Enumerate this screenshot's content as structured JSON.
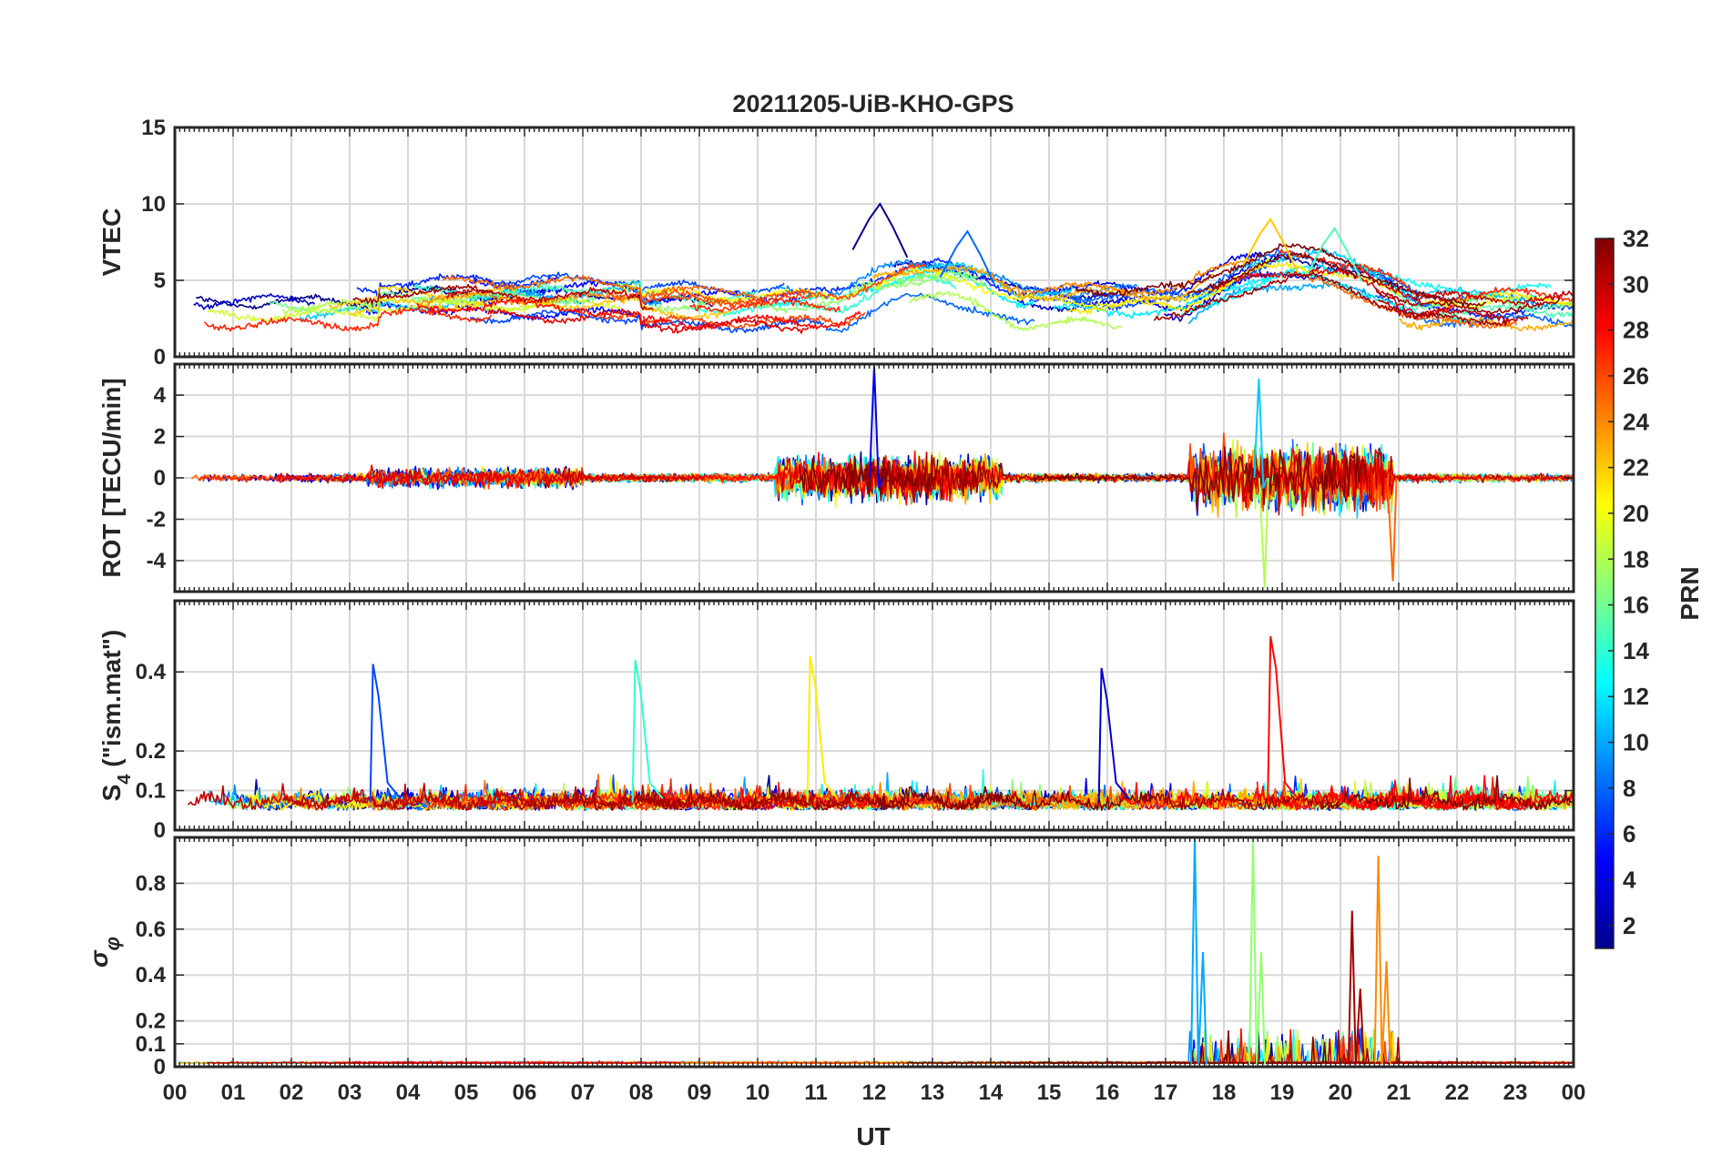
{
  "colors": {
    "axis": "#262626",
    "grid": "#d9d9d9",
    "background": "#ffffff",
    "colormap": [
      "#00008f",
      "#0000ff",
      "#0080ff",
      "#00ffff",
      "#80ff80",
      "#ffff00",
      "#ff8000",
      "#ff0000",
      "#800000"
    ]
  },
  "chart_data": {
    "type": "line",
    "title": "20211205-UiB-KHO-GPS",
    "x_axis": {
      "label": "UT",
      "range_hours": [
        0,
        24
      ],
      "tick_labels": [
        "00",
        "01",
        "02",
        "03",
        "04",
        "05",
        "06",
        "07",
        "08",
        "09",
        "10",
        "11",
        "12",
        "13",
        "14",
        "15",
        "16",
        "17",
        "18",
        "19",
        "20",
        "21",
        "22",
        "23",
        "00"
      ]
    },
    "grid": true,
    "colorbar": {
      "label": "PRN",
      "range": [
        1,
        32
      ],
      "tick_labels": [
        "2",
        "4",
        "6",
        "8",
        "10",
        "12",
        "14",
        "16",
        "18",
        "20",
        "22",
        "24",
        "26",
        "28",
        "30",
        "32"
      ],
      "colormap": "jet",
      "placement": "right"
    },
    "panels": [
      {
        "id": "vtec",
        "ylabel": "VTEC",
        "ylim": [
          0,
          15
        ],
        "ytick_labels": [
          "0",
          "5",
          "10",
          "15"
        ],
        "ytick_values": [
          0,
          5,
          10,
          15
        ],
        "events": [
          {
            "hour": 12.1,
            "peak": 10.0
          },
          {
            "hour": 13.6,
            "peak": 8.2
          },
          {
            "hour": 19.9,
            "peak": 8.4
          },
          {
            "hour": 18.8,
            "peak": 9.0
          }
        ]
      },
      {
        "id": "rot",
        "ylabel": "ROT [TECU/min]",
        "ylim": [
          -5.5,
          5.5
        ],
        "ytick_labels": [
          "-4",
          "-2",
          "0",
          "2",
          "4"
        ],
        "ytick_values": [
          -4,
          -2,
          0,
          2,
          4
        ],
        "events": [
          {
            "hour": 12.0,
            "peak": 5.4
          },
          {
            "hour": 18.6,
            "peak": 4.8
          },
          {
            "hour": 18.7,
            "peak": -5.3
          },
          {
            "hour": 20.9,
            "peak": -5.0
          }
        ]
      },
      {
        "id": "s4",
        "ylabel": "S4 (\"ism.mat\")",
        "ylim": [
          0,
          0.58
        ],
        "ytick_labels": [
          "0",
          "0.1",
          "0.2",
          "0.4"
        ],
        "ytick_values": [
          0,
          0.1,
          0.2,
          0.4
        ],
        "events": [
          {
            "hour": 3.4,
            "peak": 0.42
          },
          {
            "hour": 7.9,
            "peak": 0.43
          },
          {
            "hour": 10.9,
            "peak": 0.44
          },
          {
            "hour": 18.8,
            "peak": 0.49
          },
          {
            "hour": 15.9,
            "peak": 0.41
          }
        ]
      },
      {
        "id": "sigma_phi",
        "ylabel": "σ φ",
        "ylim": [
          0,
          1.0
        ],
        "ytick_labels": [
          "0",
          "0.1",
          "0.2",
          "0.4",
          "0.6",
          "0.8"
        ],
        "ytick_values": [
          0,
          0.1,
          0.2,
          0.4,
          0.6,
          0.8
        ],
        "events": [
          {
            "hour": 17.5,
            "peak": 1.0
          },
          {
            "hour": 18.5,
            "peak": 1.0
          },
          {
            "hour": 20.65,
            "peak": 0.92
          },
          {
            "hour": 20.2,
            "peak": 0.68
          }
        ]
      }
    ]
  }
}
